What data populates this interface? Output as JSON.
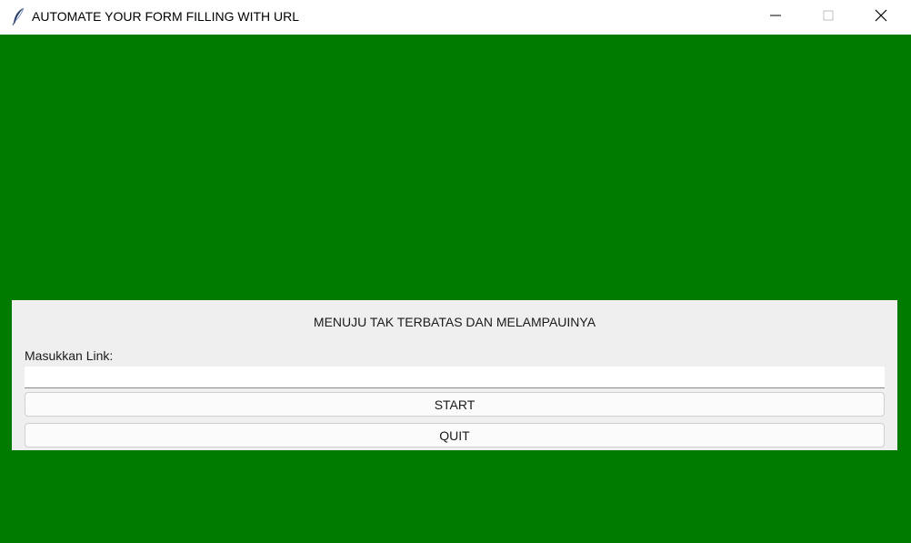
{
  "window": {
    "title": "AUTOMATE YOUR FORM FILLING WITH URL",
    "icon": "feather-icon",
    "controls": {
      "minimize": "minimize-icon",
      "maximize": "maximize-icon",
      "close": "close-icon"
    },
    "background_color": "#007b00"
  },
  "panel": {
    "headline": "MENUJU TAK TERBATAS DAN MELAMPAUINYA",
    "link_label": "Masukkan Link:",
    "link_value": "",
    "start_label": "START",
    "quit_label": "QUIT",
    "background_color": "#efefef"
  }
}
